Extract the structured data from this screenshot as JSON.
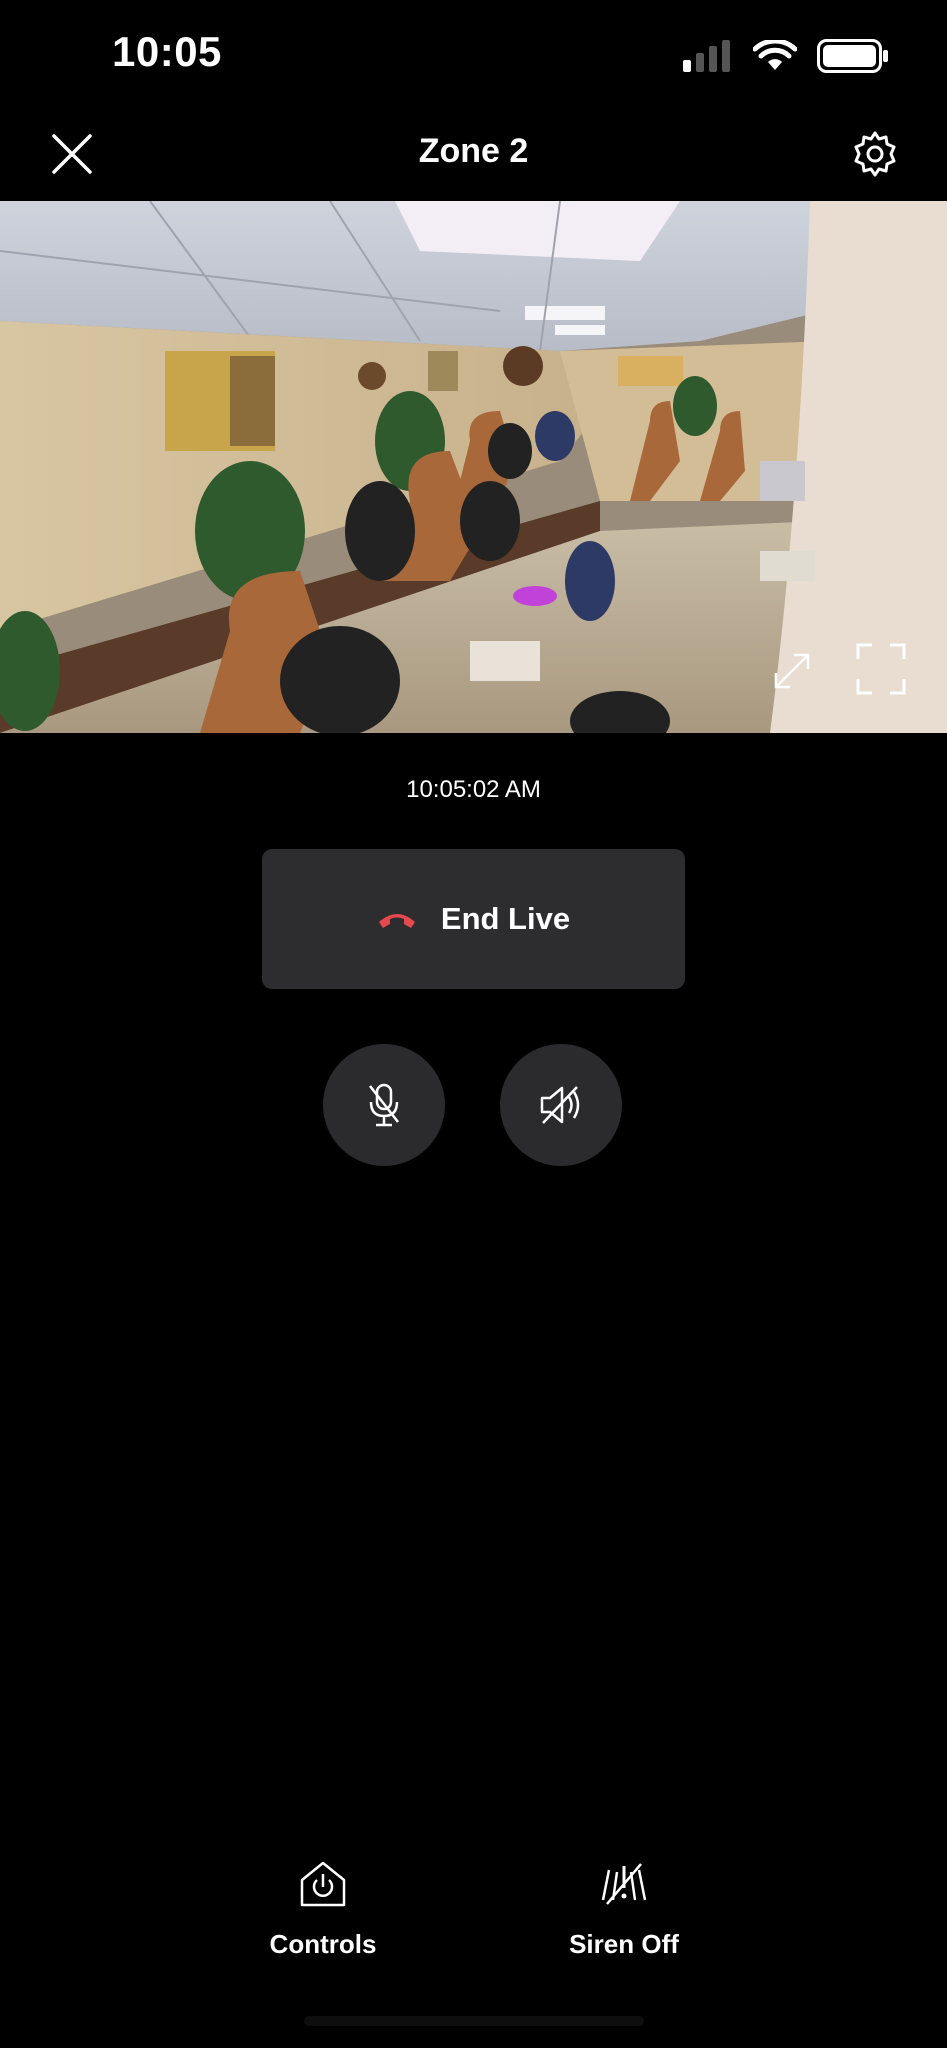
{
  "status_bar": {
    "time": "10:05",
    "icons": [
      "cellular-signal-icon",
      "wifi-icon",
      "battery-icon"
    ]
  },
  "header": {
    "title": "Zone 2",
    "close_icon": "close-icon",
    "settings_icon": "gear-icon"
  },
  "video": {
    "description_icons": [
      "expand-icon",
      "fullscreen-icon"
    ]
  },
  "timestamp": "10:05:02 AM",
  "end_live": {
    "label": "End Live",
    "icon": "hang-up-icon",
    "icon_color": "#e5484d"
  },
  "audio_controls": {
    "mic_icon": "mic-muted-icon",
    "speaker_icon": "speaker-muted-icon"
  },
  "bottom_nav": {
    "items": [
      {
        "label": "Controls",
        "icon": "power-home-icon"
      },
      {
        "label": "Siren Off",
        "icon": "siren-off-icon"
      }
    ]
  },
  "colors": {
    "background": "#000000",
    "button_bg": "#2d2d2f",
    "accent_red": "#e5484d"
  }
}
